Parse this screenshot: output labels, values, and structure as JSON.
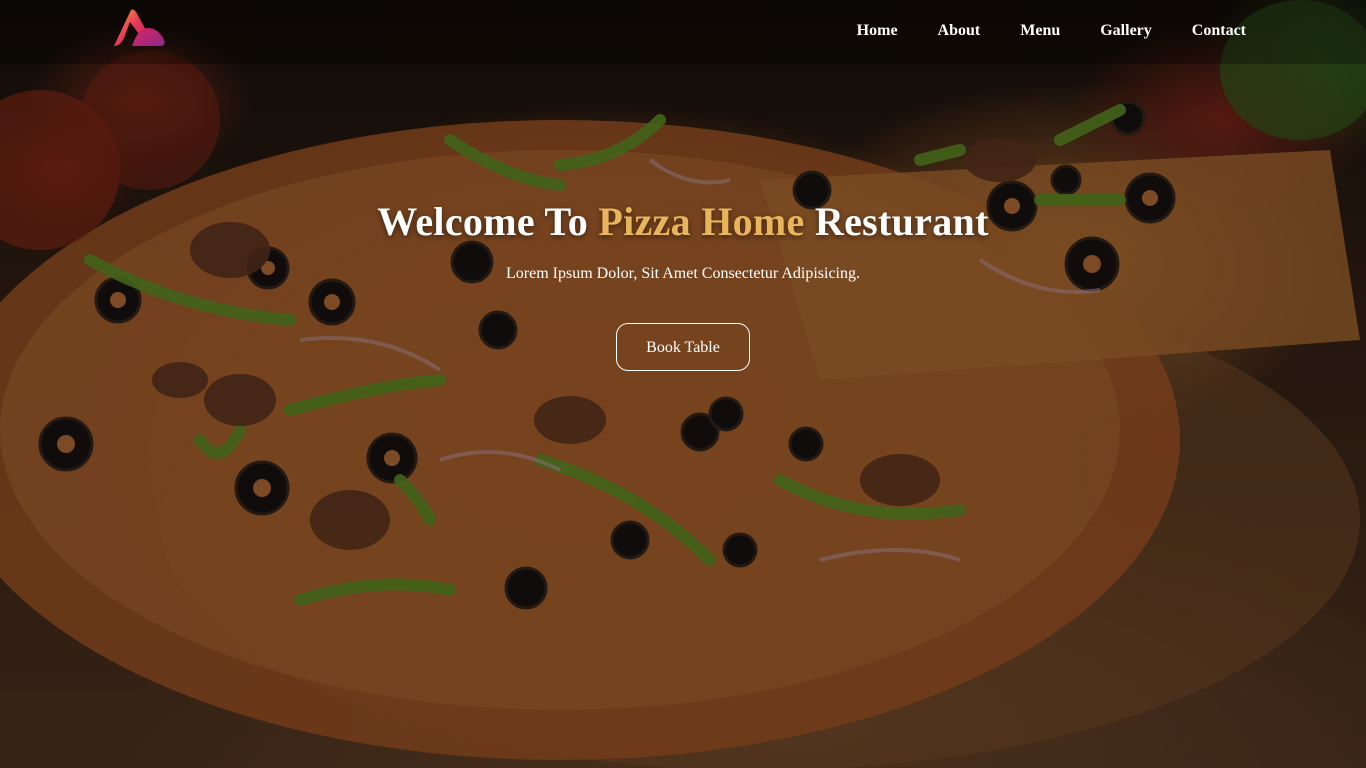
{
  "navbar": {
    "logo_icon": "brand-triangle-logo-icon",
    "links": [
      {
        "label": "Home"
      },
      {
        "label": "About"
      },
      {
        "label": "Menu"
      },
      {
        "label": "Gallery"
      },
      {
        "label": "Contact"
      }
    ]
  },
  "hero": {
    "title_start": "Welcome To ",
    "title_accent": "Pizza Home",
    "title_end": " Resturant",
    "subtitle": "Lorem Ipsum Dolor, Sit Amet Consectetur Adipisicing.",
    "cta_label": "Book Table",
    "background_image": "pizza-photo"
  },
  "colors": {
    "accent": "#e8b45c",
    "logo_gradient": [
      "#f5a623",
      "#e0245e",
      "#a0308a"
    ]
  }
}
